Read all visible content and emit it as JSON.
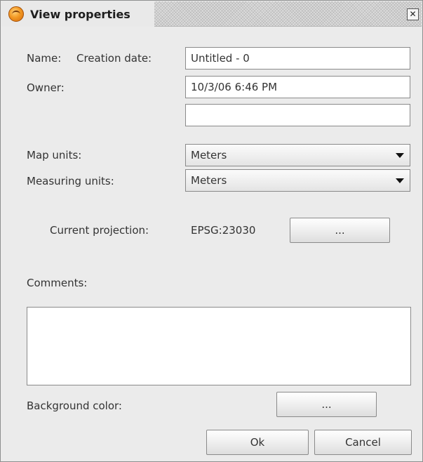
{
  "window": {
    "title": "View properties",
    "close_glyph": "✕"
  },
  "labels": {
    "name": "Name:",
    "creation_date": "Creation date:",
    "owner": "Owner:",
    "map_units": "Map units:",
    "measuring_units": "Measuring units:",
    "current_projection": "Current projection:",
    "projection_value": "EPSG:23030",
    "comments": "Comments:",
    "background_color": "Background color:"
  },
  "fields": {
    "name_value": "Untitled - 0",
    "date_value": "10/3/06 6:46 PM",
    "owner_value": ""
  },
  "selects": {
    "map_units": "Meters",
    "measuring_units": "Meters"
  },
  "buttons": {
    "projection": "...",
    "background_color": "...",
    "ok": "Ok",
    "cancel": "Cancel"
  },
  "comments_text": ""
}
